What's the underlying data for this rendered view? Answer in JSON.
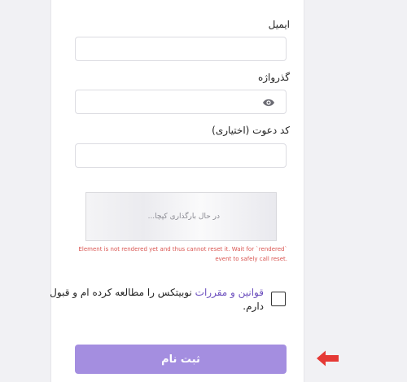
{
  "form": {
    "email": {
      "label": "ایمیل",
      "value": ""
    },
    "password": {
      "label": "گذرواژه",
      "value": "",
      "toggle_icon": "eye-icon"
    },
    "invite_code": {
      "label": "کد دعوت (اختیاری)",
      "value": ""
    },
    "captcha": {
      "loading_text": "در حال بارگذاری کپچا...",
      "error_line1": "Element is not rendered yet and thus cannot reset it. Wait for `rendered`",
      "error_line2": "event to safely call reset."
    },
    "terms": {
      "link_text": "قوانین و مقررات",
      "text_after_link": " نوبیتکس را مطالعه کرده ام و قبول",
      "text_line2": "دارم.",
      "checked": false
    },
    "submit_label": "ثبت نام"
  },
  "colors": {
    "accent": "#a48ee0",
    "link": "#6c4fbe",
    "error": "#d9534f",
    "annotation_arrow": "#e53935"
  },
  "icons": {
    "password_toggle": "eye-icon",
    "annotation": "arrow-left-icon"
  }
}
